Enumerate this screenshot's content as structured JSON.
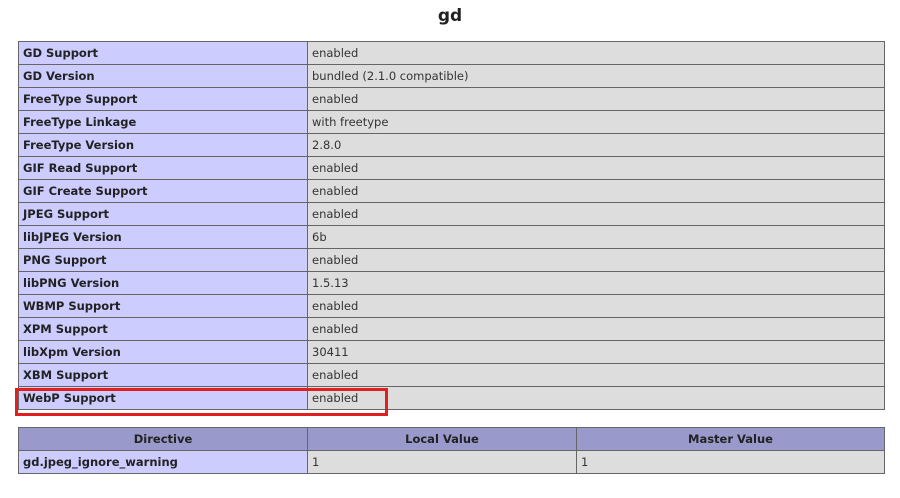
{
  "module_title": "gd",
  "gd_rows": [
    {
      "name": "GD Support",
      "value": "enabled"
    },
    {
      "name": "GD Version",
      "value": "bundled (2.1.0 compatible)"
    },
    {
      "name": "FreeType Support",
      "value": "enabled"
    },
    {
      "name": "FreeType Linkage",
      "value": "with freetype"
    },
    {
      "name": "FreeType Version",
      "value": "2.8.0"
    },
    {
      "name": "GIF Read Support",
      "value": "enabled"
    },
    {
      "name": "GIF Create Support",
      "value": "enabled"
    },
    {
      "name": "JPEG Support",
      "value": "enabled"
    },
    {
      "name": "libJPEG Version",
      "value": "6b"
    },
    {
      "name": "PNG Support",
      "value": "enabled"
    },
    {
      "name": "libPNG Version",
      "value": "1.5.13"
    },
    {
      "name": "WBMP Support",
      "value": "enabled"
    },
    {
      "name": "XPM Support",
      "value": "enabled"
    },
    {
      "name": "libXpm Version",
      "value": "30411"
    },
    {
      "name": "XBM Support",
      "value": "enabled"
    },
    {
      "name": "WebP Support",
      "value": "enabled"
    }
  ],
  "directive_table": {
    "headers": [
      "Directive",
      "Local Value",
      "Master Value"
    ],
    "rows": [
      {
        "directive": "gd.jpeg_ignore_warning",
        "local": "1",
        "master": "1"
      }
    ]
  },
  "highlight_color": "#e0201e",
  "colors": {
    "name_cell": "#ccccff",
    "value_cell": "#dddddd",
    "header_cell": "#9999cc"
  }
}
